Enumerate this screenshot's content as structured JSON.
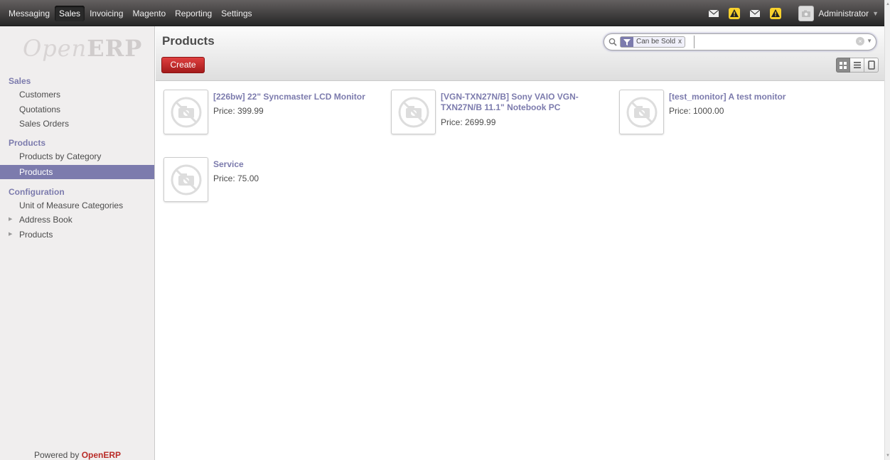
{
  "topbar": {
    "menu": [
      "Messaging",
      "Sales",
      "Invoicing",
      "Magento",
      "Reporting",
      "Settings"
    ],
    "active": "Sales",
    "user": "Administrator"
  },
  "sidebar": {
    "logo": {
      "open": "Open",
      "erp": "ERP"
    },
    "sections": [
      {
        "title": "Sales",
        "items": [
          "Customers",
          "Quotations",
          "Sales Orders"
        ]
      },
      {
        "title": "Products",
        "items": [
          "Products by Category",
          "Products"
        ]
      },
      {
        "title": "Configuration",
        "items": [
          "Unit of Measure Categories",
          "Address Book",
          "Products"
        ]
      }
    ],
    "active_item": "Products",
    "powered_prefix": "Powered by",
    "powered_brand": "OpenERP"
  },
  "header": {
    "title": "Products",
    "create_label": "Create",
    "search": {
      "facet": "Can be Sold",
      "facet_remove": "x",
      "value": ""
    }
  },
  "products": [
    {
      "name": "[226bw] 22\" Syncmaster LCD Monitor",
      "price": "Price: 399.99"
    },
    {
      "name": "[VGN-TXN27N/B] Sony VAIO VGN-TXN27N/B 11.1\" Notebook PC",
      "price": "Price: 2699.99"
    },
    {
      "name": "[test_monitor] A test monitor",
      "price": "Price: 1000.00"
    },
    {
      "name": "Service",
      "price": "Price: 75.00"
    }
  ],
  "icons": {
    "mail": "mail-icon",
    "warning": "warning-icon",
    "photo_placeholder": "no-photo-icon",
    "search": "search-icon",
    "filter": "filter-icon"
  },
  "colors": {
    "accent": "#7c7bad",
    "create_button": "#c62828",
    "warning_badge": "#f8d12c"
  }
}
